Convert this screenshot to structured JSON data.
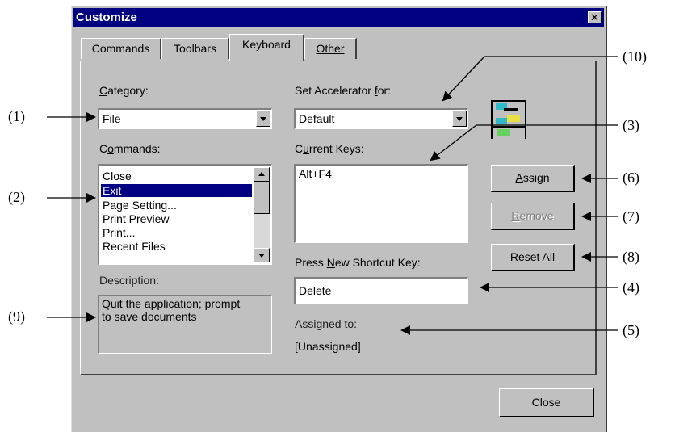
{
  "dialog": {
    "title": "Customize",
    "close_x": "✕",
    "tabs": [
      "Commands",
      "Toolbars",
      "Keyboard",
      "Other"
    ]
  },
  "left": {
    "category_label_pre": "",
    "category_label_key": "C",
    "category_label_post": "ategory:",
    "category_value": "File",
    "commands_label_pre": "C",
    "commands_label_key": "o",
    "commands_label_post": "mmands:",
    "commands": [
      "Close",
      "Exit",
      "Page Setting...",
      "Print Preview",
      "Print...",
      "Recent Files"
    ],
    "selected_command": "Exit",
    "description_label": "Description:",
    "description_text_1": "Quit the application; prompt",
    "description_text_2": "to save documents"
  },
  "right": {
    "accel_label_pre": "Set Accelerator ",
    "accel_label_key": "f",
    "accel_label_post": "or:",
    "accel_value": "Default",
    "current_keys_label_pre": "C",
    "current_keys_label_key": "u",
    "current_keys_label_post": "rrent Keys:",
    "current_keys": [
      "Alt+F4"
    ],
    "new_key_label_pre": "Press ",
    "new_key_label_key": "N",
    "new_key_label_post": "ew Shortcut Key:",
    "new_key_value": "Delete",
    "assigned_label": "Assigned to:",
    "assigned_value": "[Unassigned]"
  },
  "buttons": {
    "assign_key": "A",
    "assign_rest": "ssign",
    "remove_key": "R",
    "remove_rest": "emove",
    "reset_pre": "Re",
    "reset_key": "s",
    "reset_post": "et All",
    "close": "Close"
  },
  "annotations": [
    "(1)",
    "(2)",
    "(3)",
    "(4)",
    "(5)",
    "(6)",
    "(7)",
    "(8)",
    "(9)",
    "(10)"
  ],
  "colors": {
    "title_bar": "#000080",
    "dialog_face": "#c0c0c0",
    "selection": "#000080"
  }
}
